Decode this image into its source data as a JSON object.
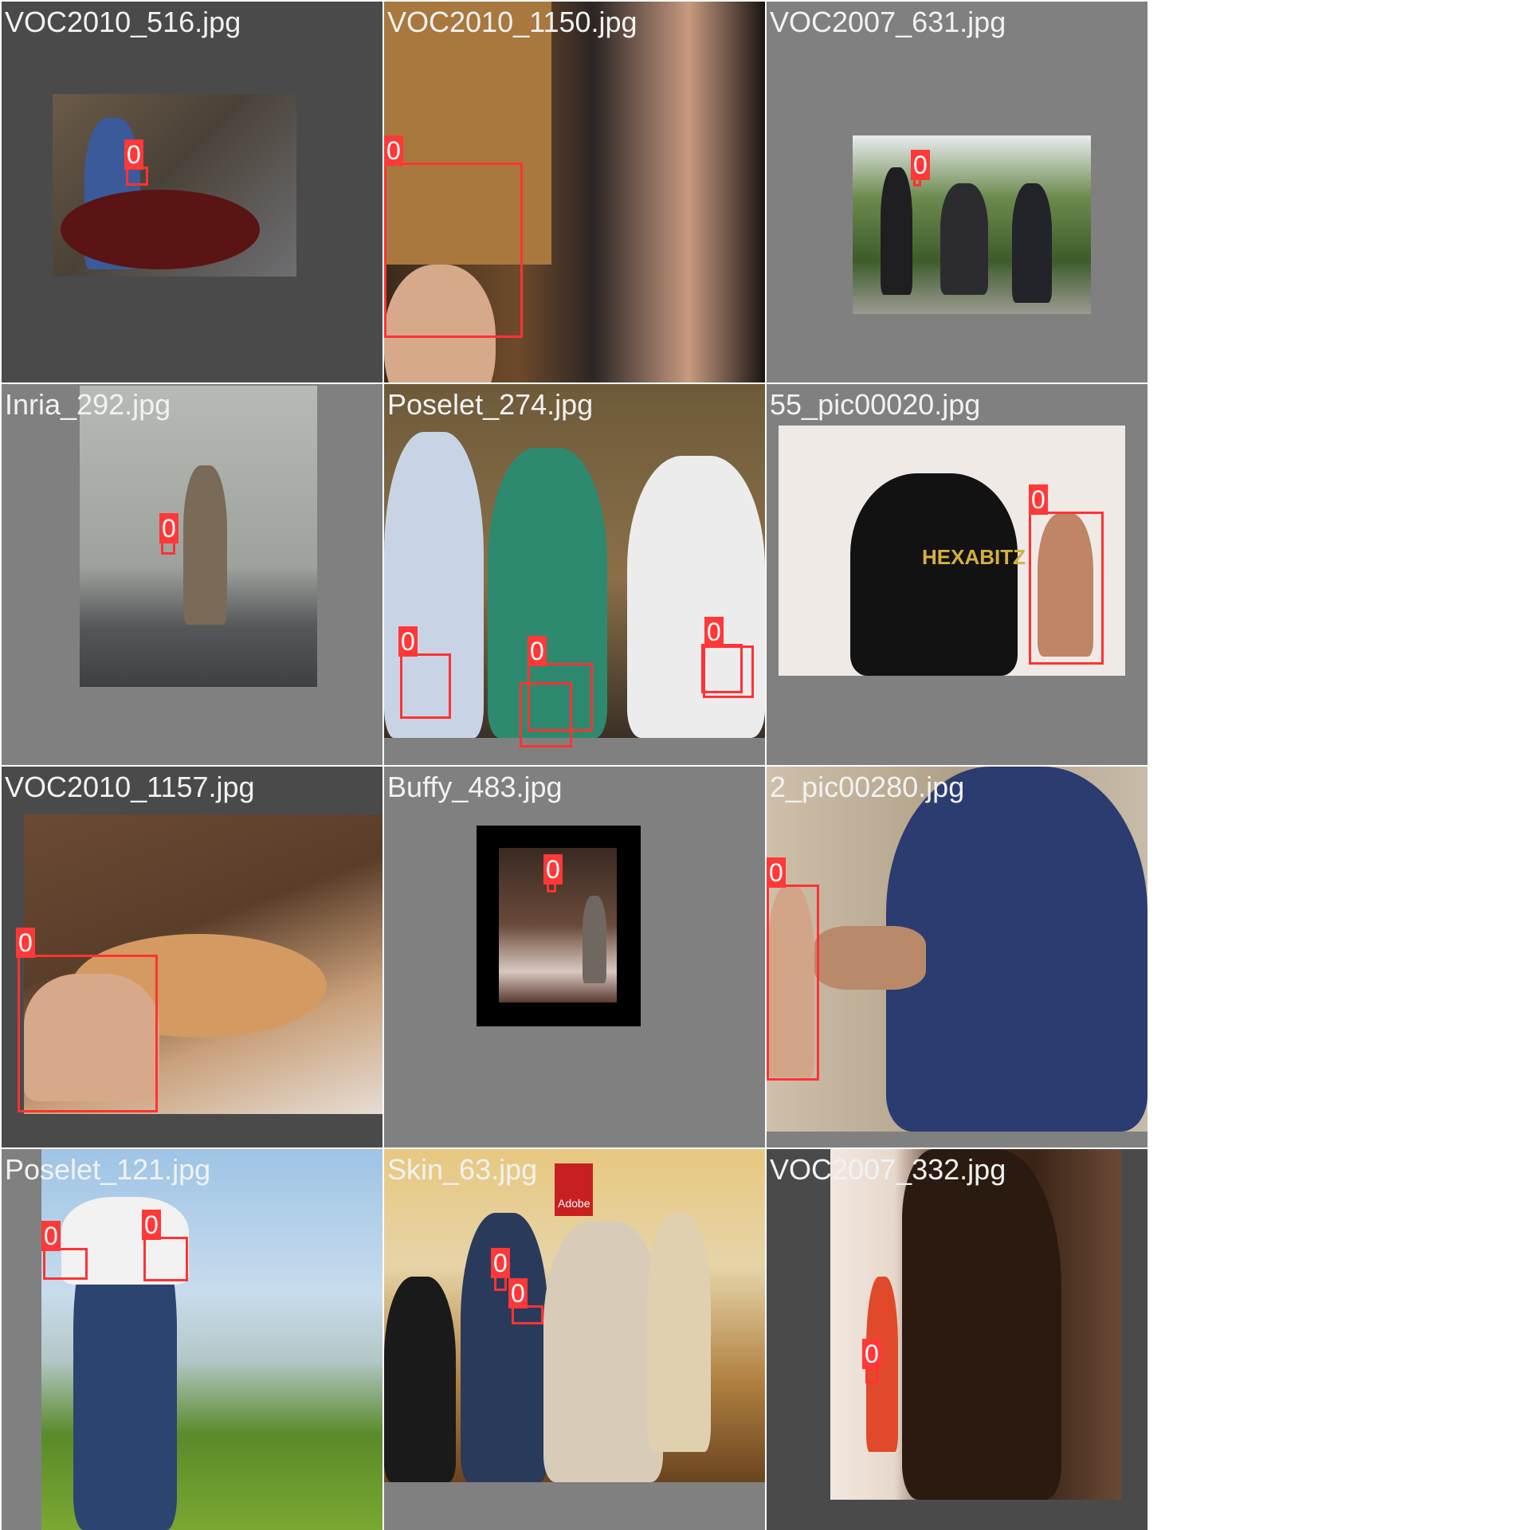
{
  "colors": {
    "box": "#ff3333",
    "label_bg": "#ff3838",
    "label_text": "#ffffff",
    "pad_dark": "#4a4a4a",
    "pad_mid": "#808080"
  },
  "tiles": [
    {
      "filename": "VOC2010_516.jpg"
    },
    {
      "filename": "VOC2010_1150.jpg"
    },
    {
      "filename": "VOC2007_631.jpg"
    },
    {
      "filename": "Inria_292.jpg"
    },
    {
      "filename": "Poselet_274.jpg"
    },
    {
      "filename": "55_pic00020.jpg",
      "shirt_text": "HEXABITZ"
    },
    {
      "filename": "VOC2010_1157.jpg"
    },
    {
      "filename": "Buffy_483.jpg"
    },
    {
      "filename": "2_pic00280.jpg"
    },
    {
      "filename": "Poselet_121.jpg"
    },
    {
      "filename": "Skin_63.jpg",
      "sign_text": "Adobe"
    },
    {
      "filename": "VOC2007_332.jpg"
    }
  ],
  "box_label": "0"
}
